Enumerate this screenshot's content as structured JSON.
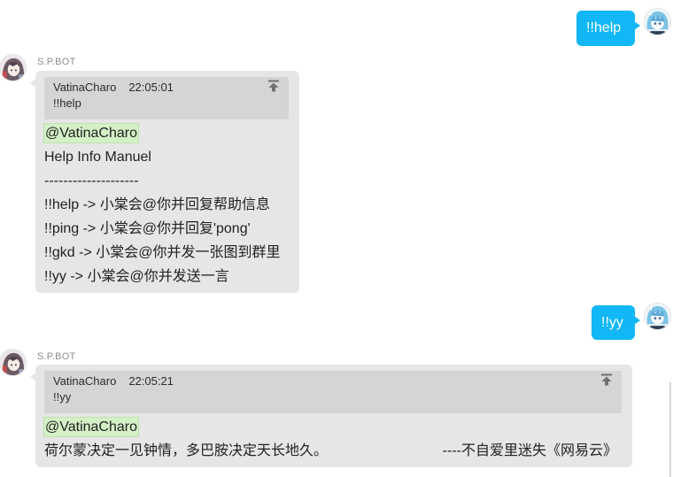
{
  "colors": {
    "outgoing_bubble": "#12b7f5",
    "incoming_bubble": "#e6e6e6",
    "quote_background": "#d5d5d5",
    "mention_highlight": "#d3f0c6",
    "sender_name": "#8c8c8c"
  },
  "icons": {
    "bot_avatar": "bot-avatar-icon",
    "user_avatar": "user-avatar-icon",
    "jump_to_quote": "jump-to-top-icon"
  },
  "messages": [
    {
      "text": "!!help"
    },
    {
      "sender": "S.P.BOT",
      "quote": {
        "user": "VatinaCharo",
        "time": "22:05:01",
        "text": "!!help"
      },
      "mention": "@VatinaCharo",
      "lines": [
        "Help Info Manuel",
        "--------------------",
        "!!help -> 小棠会@你并回复帮助信息",
        "!!ping -> 小棠会@你并回复'pong'",
        "!!gkd -> 小棠会@你并发一张图到群里",
        "!!yy -> 小棠会@你并发送一言"
      ]
    },
    {
      "text": "!!yy"
    },
    {
      "sender": "S.P.BOT",
      "quote": {
        "user": "VatinaCharo",
        "time": "22:05:21",
        "text": "!!yy"
      },
      "mention": "@VatinaCharo",
      "body": "荷尔蒙决定一见钟情，多巴胺决定天长地久。",
      "signature": "----不自爱里迷失《网易云》"
    }
  ]
}
